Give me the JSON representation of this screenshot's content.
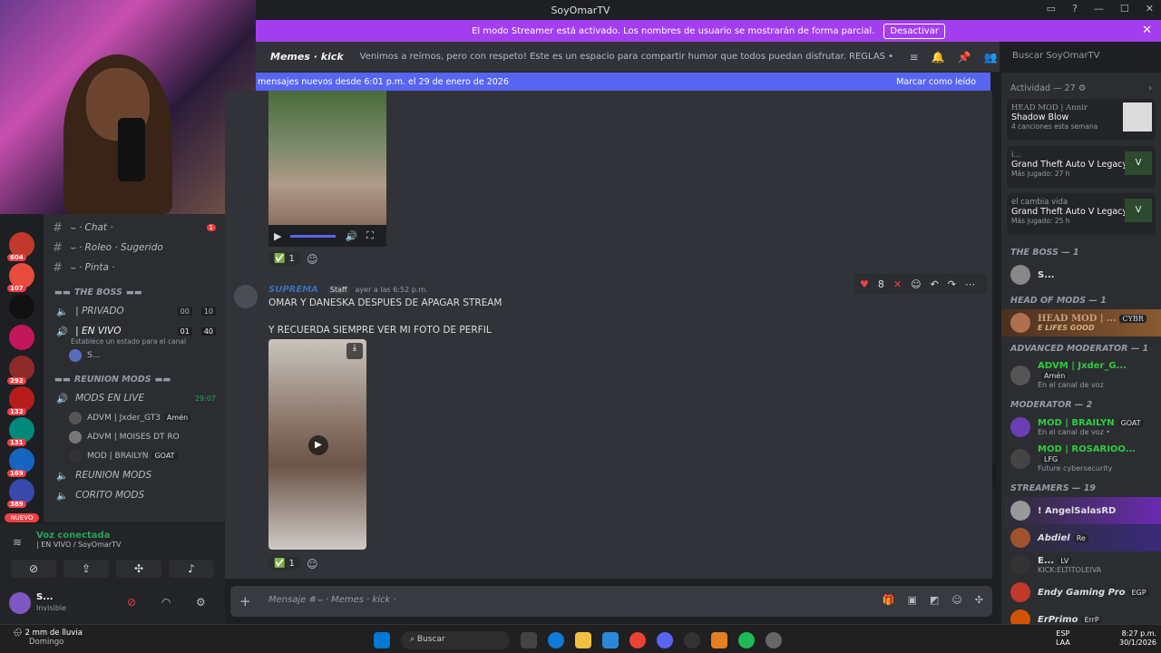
{
  "title_bar": {
    "title": "SoyOmarTV"
  },
  "banner": {
    "text": "El modo Streamer está activado. Los nombres de usuario se mostrarán de forma parcial.",
    "button": "Desactivar"
  },
  "channel_header": {
    "name": "Memes · kick",
    "topic": "Venimos a reírnos, pero con respeto! Este es un espacio para compartir humor que todos puedan disfrutar. REGLAS  • No envíes memes que co...",
    "search_placeholder": "Buscar SoyOmarTV"
  },
  "new_bar": {
    "text": "mensajes nuevos desde 6:01 p.m. el 29 de enero de 2026",
    "mark": "Marcar como leído"
  },
  "servers": {
    "badges": [
      "604",
      "107",
      "292",
      "132",
      "131",
      "169",
      "389"
    ],
    "new_label": "NUEVO"
  },
  "channels": {
    "top": [
      {
        "name": "Chat ·",
        "badge": "1"
      },
      {
        "name": "Roleo · Sugerido"
      },
      {
        "name": "Pinta ·"
      }
    ],
    "cat_boss": "THE BOSS",
    "privado": "| PRIVADO",
    "privado_counts": [
      "00",
      "10"
    ],
    "envivo": "| EN VIVO",
    "envivo_counts": [
      "01",
      "40"
    ],
    "envivo_status": "Establece un estado para el canal",
    "envivo_user": "S...",
    "cat_reunion": "REUNION MODS",
    "mods_live": "MODS EN LIVE",
    "mods_live_time": "29:07",
    "mods_users": [
      {
        "name": "ADVM | Jxder_GT3",
        "tag": "Amén"
      },
      {
        "name": "ADVM | MOISES DT RO",
        "tag": ""
      },
      {
        "name": "MOD | BRAILYN",
        "tag": "GOAT"
      }
    ],
    "reunion_mods": "REUNION MODS",
    "corito_mods": "CORITO MODS"
  },
  "voice": {
    "status": "Voz conectada",
    "channel": "| EN VIVO / SoyOmarTV",
    "user": "S...",
    "user_status": "Invisible"
  },
  "message1": {
    "reaction_count": "1"
  },
  "message2": {
    "author": "SUPREMA",
    "role": "Staff",
    "time": "ayer a las 6:52 p.m.",
    "line1": "OMAR Y DANESKA DESPUES DE APAGAR STREAM",
    "line2": "Y RECUERDA SIEMPRE VER MI FOTO DE PERFIL",
    "reaction_count": "1",
    "toolbar_count": "8"
  },
  "composer": {
    "placeholder": "Mensaje #⌣ · Memes · kick ·"
  },
  "members": {
    "activity_title": "Actividad — 27",
    "activities": [
      {
        "user": "HEAD MOD | Annir",
        "title": "Shadow Blow",
        "sub": "4 canciones esta semana"
      },
      {
        "user": "i...",
        "title": "Grand Theft Auto V Legacy",
        "sub": "Más jugado: 27 h"
      },
      {
        "user": "el cambia vida",
        "title": "Grand Theft Auto V Legacy",
        "sub": "Más jugado: 25 h"
      }
    ],
    "cat_boss": "THE BOSS — 1",
    "boss_user": "S...",
    "cat_head": "HEAD OF MODS — 1",
    "head_user": "HEAD MOD | ...",
    "head_tag": "CYBR",
    "head_sub": "E LIFES GOOD",
    "cat_adv": "ADVANCED MODERATOR — 1",
    "adv_user": "ADVM | Jxder_G...",
    "adv_tag": "Amén",
    "adv_sub": "En el canal de voz",
    "cat_mod": "MODERATOR — 2",
    "mods": [
      {
        "name": "MOD | BRAILYN",
        "tag": "GOAT",
        "sub": "En el canal de voz •"
      },
      {
        "name": "MOD | ROSARIOO...",
        "tag": "LFG",
        "sub": "Future cybersecurity"
      }
    ],
    "cat_streamers": "STREAMERS — 19",
    "streamers": [
      {
        "name": "! AngelSalasRD",
        "tag": ""
      },
      {
        "name": "Abdiel",
        "tag": "Re"
      },
      {
        "name": "E...",
        "tag": "LV",
        "sub": "KICK:ELTITOLEIVA"
      },
      {
        "name": "Endy Gaming Pro",
        "tag": "EGP"
      },
      {
        "name": "ErPrimo",
        "tag": "ErrP"
      }
    ]
  },
  "taskbar": {
    "weather": "2 mm de lluvia",
    "weather_sub": "Domingo",
    "search": "Buscar",
    "lang1": "ESP",
    "lang2": "LAA",
    "time": "8:27 p.m.",
    "date": "30/1/2026"
  },
  "colors": {
    "accent": "#5865f2",
    "streamer": "#a33ef0",
    "danger": "#f23f43",
    "green": "#23a55a"
  }
}
